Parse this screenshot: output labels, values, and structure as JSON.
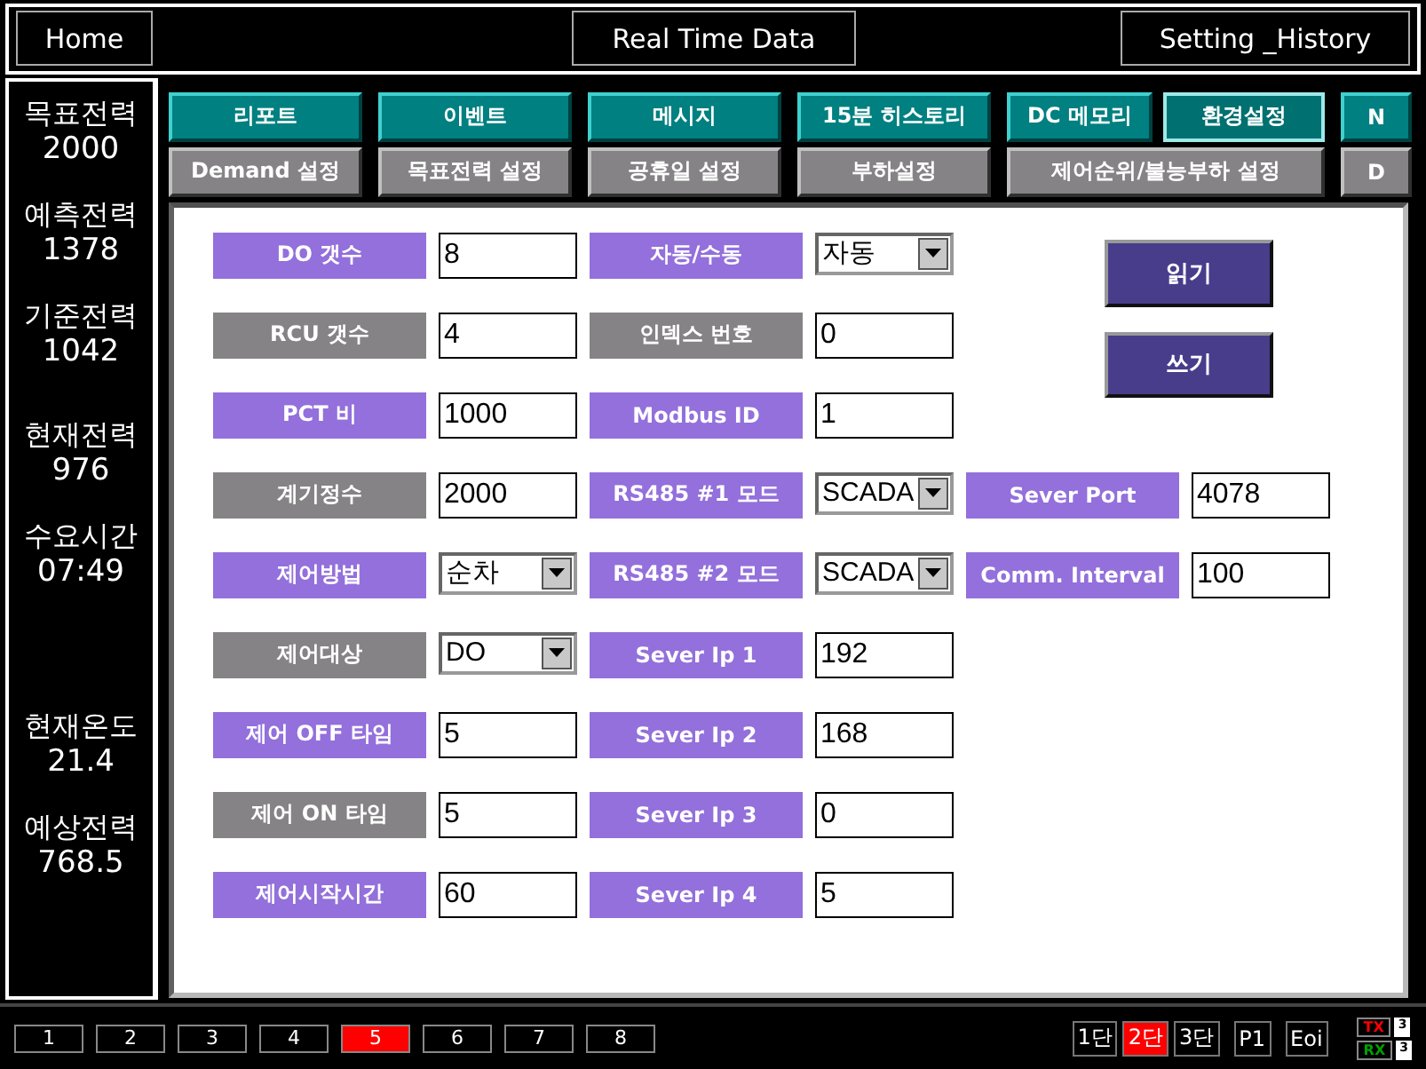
{
  "header": {
    "left": "Home",
    "center": "Real Time Data",
    "right": "Setting _History"
  },
  "sidebar": {
    "metrics": [
      {
        "label": "목표전력",
        "value": "2000"
      },
      {
        "label": "예측전력",
        "value": "1378"
      },
      {
        "label": "기준전력",
        "value": "1042"
      },
      {
        "label": "현재전력",
        "value": "976"
      },
      {
        "label": "수요시간",
        "value": "07:49"
      },
      {
        "label": "현재온도",
        "value": "21.4"
      },
      {
        "label": "예상전력",
        "value": "768.5"
      }
    ]
  },
  "nav": {
    "row_1": [
      {
        "label": "리포트",
        "selected": false
      },
      {
        "label": "이벤트",
        "selected": false
      },
      {
        "label": "메시지",
        "selected": false
      },
      {
        "label": "15분 히스토리",
        "selected": false
      },
      {
        "label": "DC 메모리",
        "selected": false
      },
      {
        "label": "환경설정",
        "selected": true
      },
      {
        "label": "N",
        "selected": false
      }
    ],
    "row_2": [
      {
        "label": "Demand 설정"
      },
      {
        "label": "목표전력 설정"
      },
      {
        "label": "공휴일 설정"
      },
      {
        "label": "부하설정"
      },
      {
        "label": "제어순위/불능부하 설정"
      },
      {
        "label": "D"
      }
    ]
  },
  "form": {
    "column_1": [
      {
        "label": "DO 갯수",
        "color": "#9370db",
        "kind": "text",
        "value": "8"
      },
      {
        "label": "RCU 갯수",
        "color": "#858385",
        "kind": "text",
        "value": "4"
      },
      {
        "label": "PCT 비",
        "color": "#9370db",
        "kind": "text",
        "value": "1000"
      },
      {
        "label": "계기정수",
        "color": "#858385",
        "kind": "text",
        "value": "2000"
      },
      {
        "label": "제어방법",
        "color": "#9370db",
        "kind": "select",
        "value": "순차"
      },
      {
        "label": "제어대상",
        "color": "#858385",
        "kind": "select",
        "value": "DO"
      },
      {
        "label": "제어 OFF 타임",
        "color": "#9370db",
        "kind": "text",
        "value": "5"
      },
      {
        "label": "제어 ON 타임",
        "color": "#858385",
        "kind": "text",
        "value": "5"
      },
      {
        "label": "제어시작시간",
        "color": "#9370db",
        "kind": "text",
        "value": "60"
      }
    ],
    "column_2": [
      {
        "label": "자동/수동",
        "color": "#9370db",
        "kind": "select",
        "value": "자동"
      },
      {
        "label": "인덱스 번호",
        "color": "#858385",
        "kind": "text",
        "value": "0"
      },
      {
        "label": "Modbus ID",
        "color": "#9370db",
        "kind": "text",
        "value": "1"
      },
      {
        "label": "RS485 #1 모드",
        "color": "#9370db",
        "kind": "select",
        "value": "SCADA"
      },
      {
        "label": "RS485 #2 모드",
        "color": "#9370db",
        "kind": "select",
        "value": "SCADA"
      },
      {
        "label": "Sever Ip 1",
        "color": "#9370db",
        "kind": "text",
        "value": "192"
      },
      {
        "label": "Sever Ip 2",
        "color": "#9370db",
        "kind": "text",
        "value": "168"
      },
      {
        "label": "Sever Ip 3",
        "color": "#9370db",
        "kind": "text",
        "value": "0"
      },
      {
        "label": "Sever Ip 4",
        "color": "#9370db",
        "kind": "text",
        "value": "5"
      }
    ],
    "buttons": [
      "읽기",
      "쓰기"
    ],
    "column_3": [
      {
        "label": "Sever Port",
        "color": "#9370db",
        "kind": "text",
        "value": "4078"
      },
      {
        "label": "Comm. Interval",
        "color": "#9370db",
        "kind": "text",
        "value": "100"
      }
    ]
  },
  "status_bar": {
    "pages": [
      {
        "label": "1",
        "selected": false
      },
      {
        "label": "2",
        "selected": false
      },
      {
        "label": "3",
        "selected": false
      },
      {
        "label": "4",
        "selected": false
      },
      {
        "label": "5",
        "selected": true
      },
      {
        "label": "6",
        "selected": false
      },
      {
        "label": "7",
        "selected": false
      },
      {
        "label": "8",
        "selected": false
      }
    ],
    "stages": [
      {
        "label": "1단",
        "selected": false
      },
      {
        "label": "2단",
        "selected": true
      },
      {
        "label": "3단",
        "selected": false
      }
    ],
    "tags": [
      "P1",
      "Eoi"
    ],
    "signals": [
      {
        "label": "TX",
        "color": "#ff0000",
        "count": "3"
      },
      {
        "label": "RX",
        "color": "#00a000",
        "count": "3"
      }
    ]
  }
}
